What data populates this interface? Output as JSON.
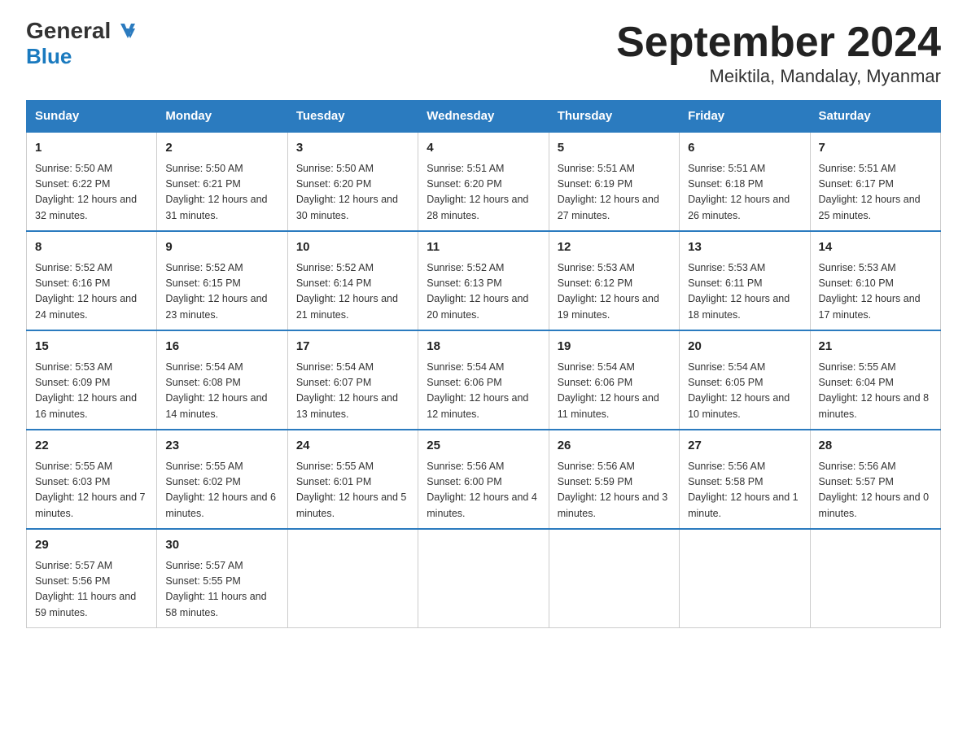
{
  "logo": {
    "text_general": "General",
    "text_blue": "Blue"
  },
  "title": "September 2024",
  "subtitle": "Meiktila, Mandalay, Myanmar",
  "days_of_week": [
    "Sunday",
    "Monday",
    "Tuesday",
    "Wednesday",
    "Thursday",
    "Friday",
    "Saturday"
  ],
  "weeks": [
    [
      {
        "day": "1",
        "sunrise": "Sunrise: 5:50 AM",
        "sunset": "Sunset: 6:22 PM",
        "daylight": "Daylight: 12 hours and 32 minutes."
      },
      {
        "day": "2",
        "sunrise": "Sunrise: 5:50 AM",
        "sunset": "Sunset: 6:21 PM",
        "daylight": "Daylight: 12 hours and 31 minutes."
      },
      {
        "day": "3",
        "sunrise": "Sunrise: 5:50 AM",
        "sunset": "Sunset: 6:20 PM",
        "daylight": "Daylight: 12 hours and 30 minutes."
      },
      {
        "day": "4",
        "sunrise": "Sunrise: 5:51 AM",
        "sunset": "Sunset: 6:20 PM",
        "daylight": "Daylight: 12 hours and 28 minutes."
      },
      {
        "day": "5",
        "sunrise": "Sunrise: 5:51 AM",
        "sunset": "Sunset: 6:19 PM",
        "daylight": "Daylight: 12 hours and 27 minutes."
      },
      {
        "day": "6",
        "sunrise": "Sunrise: 5:51 AM",
        "sunset": "Sunset: 6:18 PM",
        "daylight": "Daylight: 12 hours and 26 minutes."
      },
      {
        "day": "7",
        "sunrise": "Sunrise: 5:51 AM",
        "sunset": "Sunset: 6:17 PM",
        "daylight": "Daylight: 12 hours and 25 minutes."
      }
    ],
    [
      {
        "day": "8",
        "sunrise": "Sunrise: 5:52 AM",
        "sunset": "Sunset: 6:16 PM",
        "daylight": "Daylight: 12 hours and 24 minutes."
      },
      {
        "day": "9",
        "sunrise": "Sunrise: 5:52 AM",
        "sunset": "Sunset: 6:15 PM",
        "daylight": "Daylight: 12 hours and 23 minutes."
      },
      {
        "day": "10",
        "sunrise": "Sunrise: 5:52 AM",
        "sunset": "Sunset: 6:14 PM",
        "daylight": "Daylight: 12 hours and 21 minutes."
      },
      {
        "day": "11",
        "sunrise": "Sunrise: 5:52 AM",
        "sunset": "Sunset: 6:13 PM",
        "daylight": "Daylight: 12 hours and 20 minutes."
      },
      {
        "day": "12",
        "sunrise": "Sunrise: 5:53 AM",
        "sunset": "Sunset: 6:12 PM",
        "daylight": "Daylight: 12 hours and 19 minutes."
      },
      {
        "day": "13",
        "sunrise": "Sunrise: 5:53 AM",
        "sunset": "Sunset: 6:11 PM",
        "daylight": "Daylight: 12 hours and 18 minutes."
      },
      {
        "day": "14",
        "sunrise": "Sunrise: 5:53 AM",
        "sunset": "Sunset: 6:10 PM",
        "daylight": "Daylight: 12 hours and 17 minutes."
      }
    ],
    [
      {
        "day": "15",
        "sunrise": "Sunrise: 5:53 AM",
        "sunset": "Sunset: 6:09 PM",
        "daylight": "Daylight: 12 hours and 16 minutes."
      },
      {
        "day": "16",
        "sunrise": "Sunrise: 5:54 AM",
        "sunset": "Sunset: 6:08 PM",
        "daylight": "Daylight: 12 hours and 14 minutes."
      },
      {
        "day": "17",
        "sunrise": "Sunrise: 5:54 AM",
        "sunset": "Sunset: 6:07 PM",
        "daylight": "Daylight: 12 hours and 13 minutes."
      },
      {
        "day": "18",
        "sunrise": "Sunrise: 5:54 AM",
        "sunset": "Sunset: 6:06 PM",
        "daylight": "Daylight: 12 hours and 12 minutes."
      },
      {
        "day": "19",
        "sunrise": "Sunrise: 5:54 AM",
        "sunset": "Sunset: 6:06 PM",
        "daylight": "Daylight: 12 hours and 11 minutes."
      },
      {
        "day": "20",
        "sunrise": "Sunrise: 5:54 AM",
        "sunset": "Sunset: 6:05 PM",
        "daylight": "Daylight: 12 hours and 10 minutes."
      },
      {
        "day": "21",
        "sunrise": "Sunrise: 5:55 AM",
        "sunset": "Sunset: 6:04 PM",
        "daylight": "Daylight: 12 hours and 8 minutes."
      }
    ],
    [
      {
        "day": "22",
        "sunrise": "Sunrise: 5:55 AM",
        "sunset": "Sunset: 6:03 PM",
        "daylight": "Daylight: 12 hours and 7 minutes."
      },
      {
        "day": "23",
        "sunrise": "Sunrise: 5:55 AM",
        "sunset": "Sunset: 6:02 PM",
        "daylight": "Daylight: 12 hours and 6 minutes."
      },
      {
        "day": "24",
        "sunrise": "Sunrise: 5:55 AM",
        "sunset": "Sunset: 6:01 PM",
        "daylight": "Daylight: 12 hours and 5 minutes."
      },
      {
        "day": "25",
        "sunrise": "Sunrise: 5:56 AM",
        "sunset": "Sunset: 6:00 PM",
        "daylight": "Daylight: 12 hours and 4 minutes."
      },
      {
        "day": "26",
        "sunrise": "Sunrise: 5:56 AM",
        "sunset": "Sunset: 5:59 PM",
        "daylight": "Daylight: 12 hours and 3 minutes."
      },
      {
        "day": "27",
        "sunrise": "Sunrise: 5:56 AM",
        "sunset": "Sunset: 5:58 PM",
        "daylight": "Daylight: 12 hours and 1 minute."
      },
      {
        "day": "28",
        "sunrise": "Sunrise: 5:56 AM",
        "sunset": "Sunset: 5:57 PM",
        "daylight": "Daylight: 12 hours and 0 minutes."
      }
    ],
    [
      {
        "day": "29",
        "sunrise": "Sunrise: 5:57 AM",
        "sunset": "Sunset: 5:56 PM",
        "daylight": "Daylight: 11 hours and 59 minutes."
      },
      {
        "day": "30",
        "sunrise": "Sunrise: 5:57 AM",
        "sunset": "Sunset: 5:55 PM",
        "daylight": "Daylight: 11 hours and 58 minutes."
      },
      null,
      null,
      null,
      null,
      null
    ]
  ]
}
